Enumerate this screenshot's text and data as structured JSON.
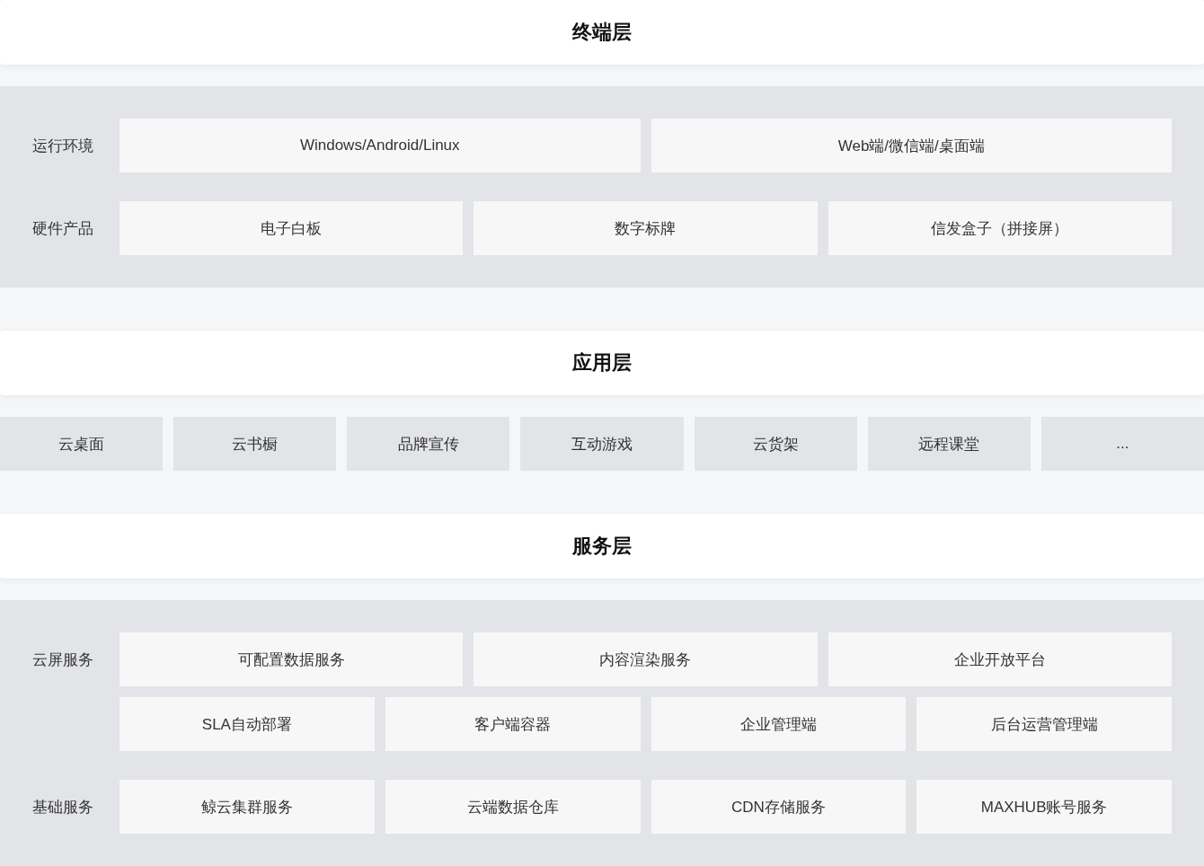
{
  "layers": [
    {
      "title": "终端层",
      "kind": "grid",
      "groups": [
        {
          "label": "运行环境",
          "rows": [
            [
              "Windows/Android/Linux",
              "Web端/微信端/桌面端"
            ]
          ]
        },
        {
          "label": "硬件产品",
          "rows": [
            [
              "电子白板",
              "数字标牌",
              "信发盒子（拼接屏）"
            ]
          ]
        }
      ]
    },
    {
      "title": "应用层",
      "kind": "chips",
      "items": [
        "云桌面",
        "云书橱",
        "品牌宣传",
        "互动游戏",
        "云货架",
        "远程课堂",
        "..."
      ]
    },
    {
      "title": "服务层",
      "kind": "grid",
      "groups": [
        {
          "label": "云屏服务",
          "rows": [
            [
              "可配置数据服务",
              "内容渲染服务",
              "企业开放平台"
            ],
            [
              "SLA自动部署",
              "客户端容器",
              "企业管理端",
              "后台运营管理端"
            ]
          ]
        },
        {
          "label": "基础服务",
          "rows": [
            [
              "鲸云集群服务",
              "云端数据仓库",
              "CDN存储服务",
              "MAXHUB账号服务"
            ]
          ]
        }
      ]
    }
  ]
}
